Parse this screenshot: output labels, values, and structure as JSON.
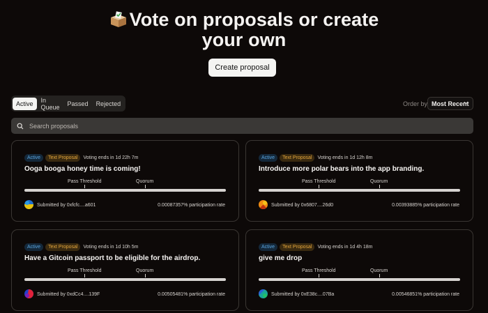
{
  "hero": {
    "emoji": "ballot-box-icon",
    "title": "Vote on proposals or create your own"
  },
  "create_button": {
    "label": "Create proposal"
  },
  "tabs": [
    {
      "label": "Active",
      "active": true
    },
    {
      "label": "In Queue",
      "active": false
    },
    {
      "label": "Passed",
      "active": false
    },
    {
      "label": "Rejected",
      "active": false
    }
  ],
  "order": {
    "label": "Order by",
    "value": "Most Recent"
  },
  "search": {
    "placeholder": "Search proposals"
  },
  "colors": {
    "background": "#0d0908",
    "active_badge": "#5aa5e0",
    "type_badge": "#e3a53c"
  },
  "labels": {
    "pass_threshold": "Pass Threshold",
    "quorum": "Quorum"
  },
  "proposals": [
    {
      "status": "Active",
      "type": "Text Proposal",
      "voting": "Voting ends in 1d 22h 7m",
      "title": "Ooga booga honey time is coming!",
      "submitted": "Submitted by 0xfcfc....a601",
      "rate": "0.00087357% participation rate",
      "progress": 0
    },
    {
      "status": "Active",
      "type": "Text Proposal",
      "voting": "Voting ends in 1d 12h 8m",
      "title": "Introduce more polar bears into the app branding.",
      "submitted": "Submitted by 0x6807....26d0",
      "rate": "0.00393885% participation rate",
      "progress": 0
    },
    {
      "status": "Active",
      "type": "Text Proposal",
      "voting": "Voting ends in 1d 10h 5m",
      "title": "Have a Gitcoin passport to be eligible for the airdrop.",
      "submitted": "Submitted by 0xdCc4....139F",
      "rate": "0.00505481% participation rate",
      "progress": 0
    },
    {
      "status": "Active",
      "type": "Text Proposal",
      "voting": "Voting ends in 1d 4h 18m",
      "title": "give me drop",
      "submitted": "Submitted by 0xE38c....07Ba",
      "rate": "0.00546851% participation rate",
      "progress": 0
    }
  ]
}
